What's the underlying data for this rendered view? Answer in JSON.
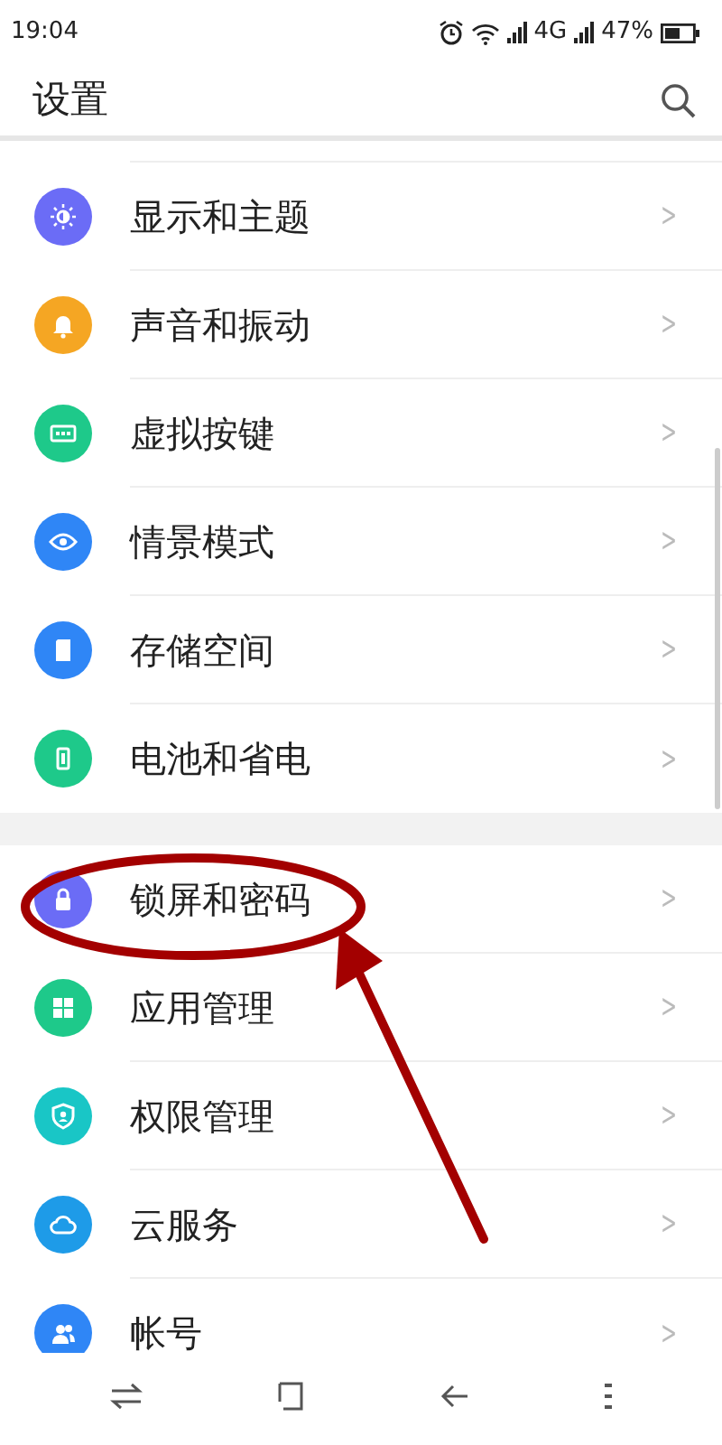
{
  "status_bar": {
    "time": "19:04",
    "network": "4G",
    "battery": "47%"
  },
  "header": {
    "title": "设置"
  },
  "groups": [
    {
      "items": [
        {
          "label": "显示和主题",
          "color": "#6b6cf6",
          "chevron": ">"
        },
        {
          "label": "声音和振动",
          "color": "#f5a623",
          "chevron": ">"
        },
        {
          "label": "虚拟按键",
          "color": "#1ec98a",
          "chevron": ">"
        },
        {
          "label": "情景模式",
          "color": "#2f86f6",
          "chevron": ">"
        },
        {
          "label": "存储空间",
          "color": "#2f86f6",
          "chevron": ">"
        },
        {
          "label": "电池和省电",
          "color": "#1ec98a",
          "chevron": ">"
        }
      ]
    },
    {
      "items": [
        {
          "label": "锁屏和密码",
          "color": "#6b6cf6",
          "chevron": ">"
        },
        {
          "label": "应用管理",
          "color": "#1ec98a",
          "chevron": ">"
        },
        {
          "label": "权限管理",
          "color": "#19c6c6",
          "chevron": ">"
        },
        {
          "label": "云服务",
          "color": "#1e9be8",
          "chevron": ">"
        },
        {
          "label": "帐号",
          "color": "#2f86f6",
          "chevron": ">"
        }
      ]
    }
  ]
}
